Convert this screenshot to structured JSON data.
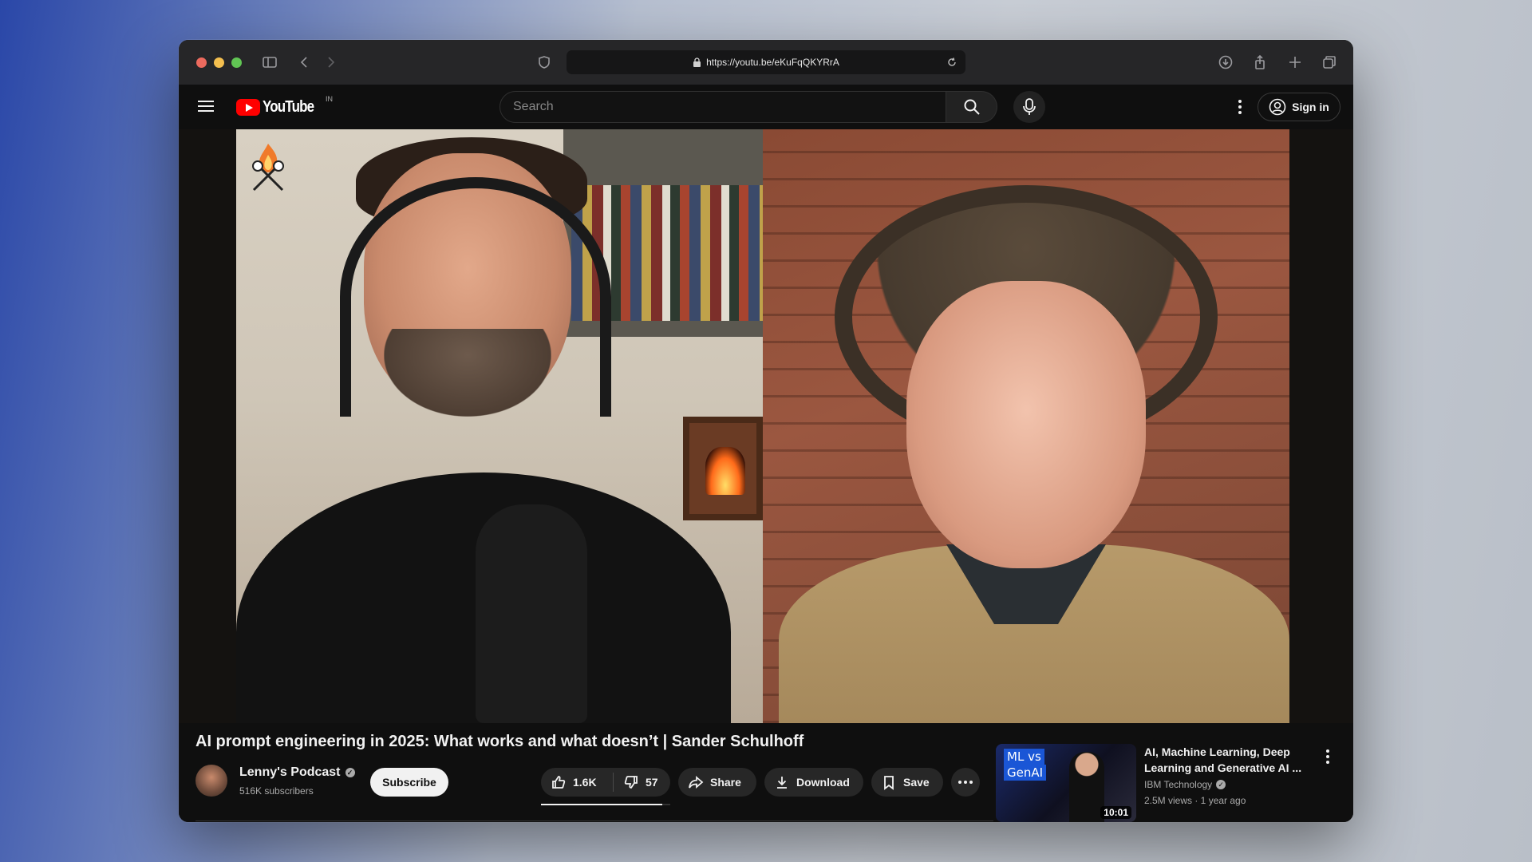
{
  "browser": {
    "url": "https://youtu.be/eKuFqQKYRrA"
  },
  "header": {
    "logo_text": "YouTube",
    "country_code": "IN",
    "search_placeholder": "Search",
    "signin_label": "Sign in"
  },
  "video": {
    "title": "AI prompt engineering in 2025: What works and what doesn’t | Sander Schulhoff",
    "channel_name": "Lenny's Podcast",
    "subscribers": "516K subscribers",
    "subscribe_label": "Subscribe",
    "likes": "1.6K",
    "likes_ratio": 0.94,
    "dislikes": "57",
    "share_label": "Share",
    "download_label": "Download",
    "save_label": "Save"
  },
  "recommended": {
    "title": "AI, Machine Learning, Deep Learning and Generative AI ...",
    "channel": "IBM Technology",
    "meta": "2.5M views · 1 year ago",
    "duration": "10:01",
    "thumb_line1": "ML vs",
    "thumb_line2": "GenAI"
  },
  "colors": {
    "youtube_red": "#ff0000",
    "background": "#0f0f0f",
    "pill": "#272727"
  }
}
